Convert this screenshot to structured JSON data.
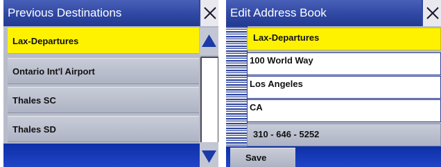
{
  "previous_destinations": {
    "title": "Previous Destinations",
    "items": [
      {
        "label": "Lax-Departures",
        "selected": true
      },
      {
        "label": "Ontario Int'l Airport",
        "selected": false
      },
      {
        "label": "Thales SC",
        "selected": false
      },
      {
        "label": "Thales SD",
        "selected": false
      }
    ]
  },
  "edit_address_book": {
    "title": "Edit Address Book",
    "name": "Lax-Departures",
    "street": "100 World Way",
    "city": "Los Angeles",
    "state": "CA",
    "phone": "310 - 646 - 5252",
    "save_label": "Save"
  },
  "colors": {
    "title_bar": "#2f48a3",
    "selected_row": "#fff200",
    "row": "#b8bcca",
    "bottom_bar": "#1538b8"
  },
  "icons": {
    "close": "close-icon",
    "scroll_up": "triangle-up-icon",
    "scroll_down": "triangle-down-icon",
    "binding": "spiral-binding-icon"
  }
}
